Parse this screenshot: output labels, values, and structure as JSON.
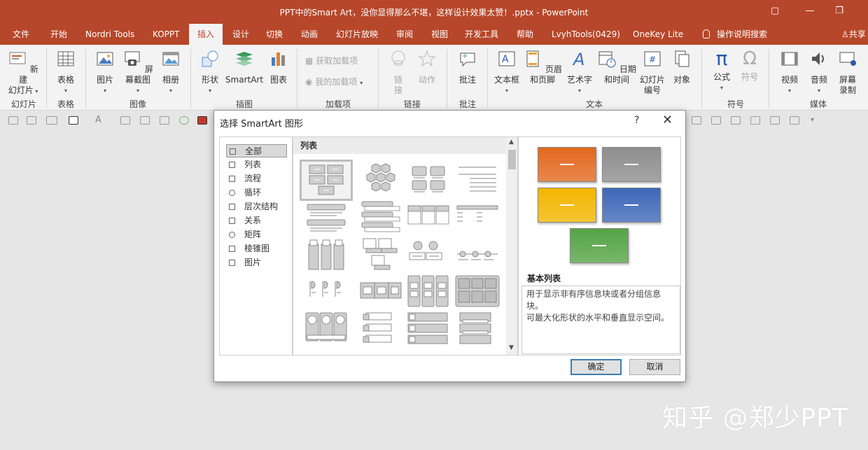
{
  "window": {
    "title": "PPT中的Smart Art，没你显得那么不堪，这样设计效果太赞！.pptx  -  PowerPoint"
  },
  "tabs": [
    "文件",
    "开始",
    "Nordri Tools",
    "KOPPT",
    "插入",
    "设计",
    "切换",
    "动画",
    "幻灯片放映",
    "审阅",
    "视图",
    "开发工具",
    "帮助",
    "LvyhTools(0429)",
    "OneKey Lite",
    "操作说明搜索",
    "共享"
  ],
  "ribbon": {
    "new_slide": "新建\n幻灯片",
    "new_slide_l1": "新建",
    "new_slide_l2": "幻灯片",
    "table": "表格",
    "picture": "图片",
    "screenshot": "屏幕截图",
    "album": "相册",
    "shapes": "形状",
    "smartart": "SmartArt",
    "chart": "图表",
    "get_addins": "获取加载项",
    "my_addins": "我的加载项",
    "link_l1": "链",
    "link_l2": "接",
    "action": "动作",
    "comment": "批注",
    "textbox": "文本框",
    "header_footer": "页眉和页脚",
    "wordart": "艺术字",
    "datetime": "日期和时间",
    "slide_num_l1": "幻灯片",
    "slide_num_l2": "编号",
    "object": "对象",
    "equation": "公式",
    "symbol": "符号",
    "video": "视频",
    "audio": "音频",
    "screen_rec_l1": "屏幕",
    "screen_rec_l2": "录制",
    "groups": [
      "幻灯片",
      "表格",
      "图像",
      "插图",
      "加载项",
      "链接",
      "批注",
      "文本",
      "符号",
      "媒体"
    ]
  },
  "dialog": {
    "title": "选择 SmartArt 图形",
    "help": "?",
    "close": "✕",
    "categories": [
      "全部",
      "列表",
      "流程",
      "循环",
      "层次结构",
      "关系",
      "矩阵",
      "棱锥图",
      "图片"
    ],
    "gallery_header": "列表",
    "preview_title": "基本列表",
    "preview_desc_l1": "用于显示非有序信息块或者分组信息块。",
    "preview_desc_l2": "可最大化形状的水平和垂直显示空间。",
    "ok": "确定",
    "cancel": "取消",
    "preview_colors": [
      "#e2691f",
      "#8e8e8e",
      "#f2b600",
      "#3d68b8",
      "#55a446"
    ]
  },
  "watermark": "知乎 @郑少PPT"
}
